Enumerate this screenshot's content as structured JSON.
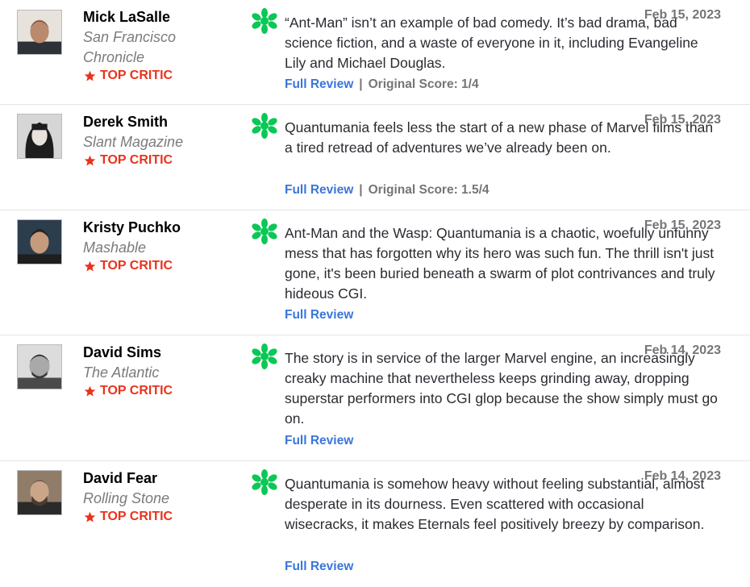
{
  "reviews": [
    {
      "critic": "Mick LaSalle",
      "publication": "San Francisco Chronicle",
      "badge": "TOP CRITIC",
      "date": "Feb 15, 2023",
      "quote": "“Ant-Man” isn’t an example of bad comedy. It’s bad drama, bad science fiction, and a waste of everyone in it, including Evangeline Lily and Michael Douglas.",
      "link": "Full Review",
      "score": "Original Score: 1/4",
      "splat_icon": "rotten-splat-icon",
      "badge_icon": "star-icon"
    },
    {
      "critic": "Derek Smith",
      "publication": "Slant Magazine",
      "badge": "TOP CRITIC",
      "date": "Feb 15, 2023",
      "quote": "Quantumania feels less the start of a new phase of Marvel films than a tired retread of adventures we’ve already been on.",
      "link": "Full Review",
      "score": "Original Score: 1.5/4",
      "splat_icon": "rotten-splat-icon",
      "badge_icon": "star-icon"
    },
    {
      "critic": "Kristy Puchko",
      "publication": "Mashable",
      "badge": "TOP CRITIC",
      "date": "Feb 15, 2023",
      "quote": "Ant-Man and the Wasp: Quantumania is a chaotic, woefully unfunny mess that has forgotten why its hero was such fun. The thrill isn't just gone, it's been buried beneath a swarm of plot contrivances and truly hideous CGI.",
      "link": "Full Review",
      "score": "",
      "splat_icon": "rotten-splat-icon",
      "badge_icon": "star-icon"
    },
    {
      "critic": "David Sims",
      "publication": "The Atlantic",
      "badge": "TOP CRITIC",
      "date": "Feb 14, 2023",
      "quote": "The story is in service of the larger Marvel engine, an increasingly creaky machine that nevertheless keeps grinding away, dropping superstar performers into CGI glop because the show simply must go on.",
      "link": "Full Review",
      "score": "",
      "splat_icon": "rotten-splat-icon",
      "badge_icon": "star-icon"
    },
    {
      "critic": "David Fear",
      "publication": "Rolling Stone",
      "badge": "TOP CRITIC",
      "date": "Feb 14, 2023",
      "quote": "Quantumania is somehow heavy without feeling substantial, almost desperate in its dourness. Even scattered with occasional wisecracks, it makes Eternals feel positively breezy by comparison.",
      "link": "Full Review",
      "score": "",
      "splat_icon": "rotten-splat-icon",
      "badge_icon": "star-icon"
    }
  ],
  "colors": {
    "splat": "#0ac855",
    "top_critic": "#e9331c",
    "link": "#3976dc",
    "muted": "#757575"
  }
}
